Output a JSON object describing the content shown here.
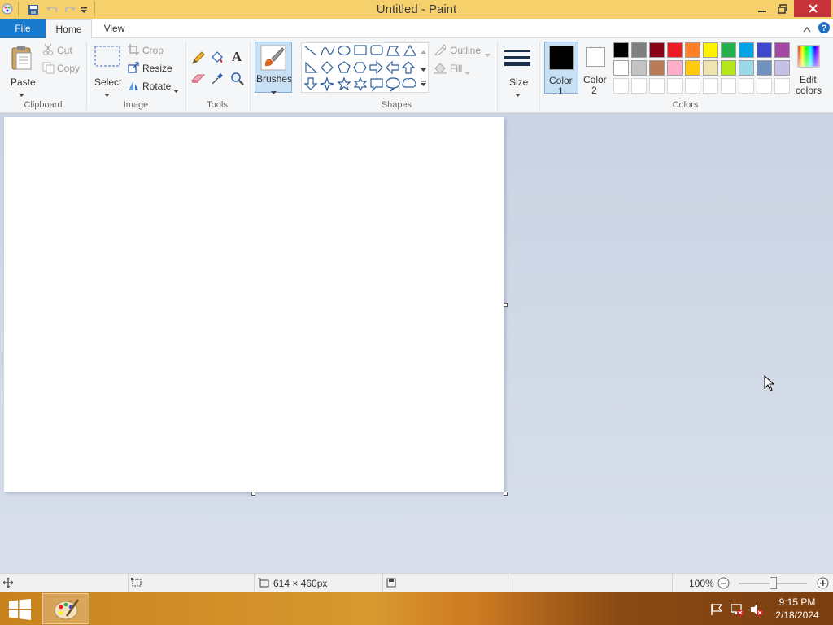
{
  "window": {
    "title": "Untitled - Paint"
  },
  "tabs": {
    "file": "File",
    "home": "Home",
    "view": "View"
  },
  "clipboard": {
    "paste": "Paste",
    "cut": "Cut",
    "copy": "Copy",
    "label": "Clipboard"
  },
  "image": {
    "select": "Select",
    "crop": "Crop",
    "resize": "Resize",
    "rotate": "Rotate",
    "label": "Image"
  },
  "tools": {
    "label": "Tools"
  },
  "brushes": {
    "label": "Brushes"
  },
  "shapes": {
    "outline": "Outline",
    "fill": "Fill",
    "label": "Shapes"
  },
  "size": {
    "label": "Size"
  },
  "colors": {
    "color1_line1": "Color",
    "color1_line2": "1",
    "color2_line1": "Color",
    "color2_line2": "2",
    "edit_line1": "Edit",
    "edit_line2": "colors",
    "label": "Colors",
    "color1_value": "#000000",
    "color2_value": "#ffffff",
    "row1": [
      "#000000",
      "#7f7f7f",
      "#880015",
      "#ed1c24",
      "#ff7f27",
      "#fff200",
      "#22b14c",
      "#00a2e8",
      "#3f48cc",
      "#a349a4"
    ],
    "row2": [
      "#ffffff",
      "#c3c3c3",
      "#b97a57",
      "#ffaec9",
      "#ffc90e",
      "#efe4b0",
      "#b5e61d",
      "#99d9ea",
      "#7092be",
      "#c8bfe7"
    ]
  },
  "status": {
    "canvas_size": "614 × 460px",
    "zoom": "100%"
  },
  "taskbar": {
    "time": "9:15 PM",
    "date": "2/18/2024"
  }
}
